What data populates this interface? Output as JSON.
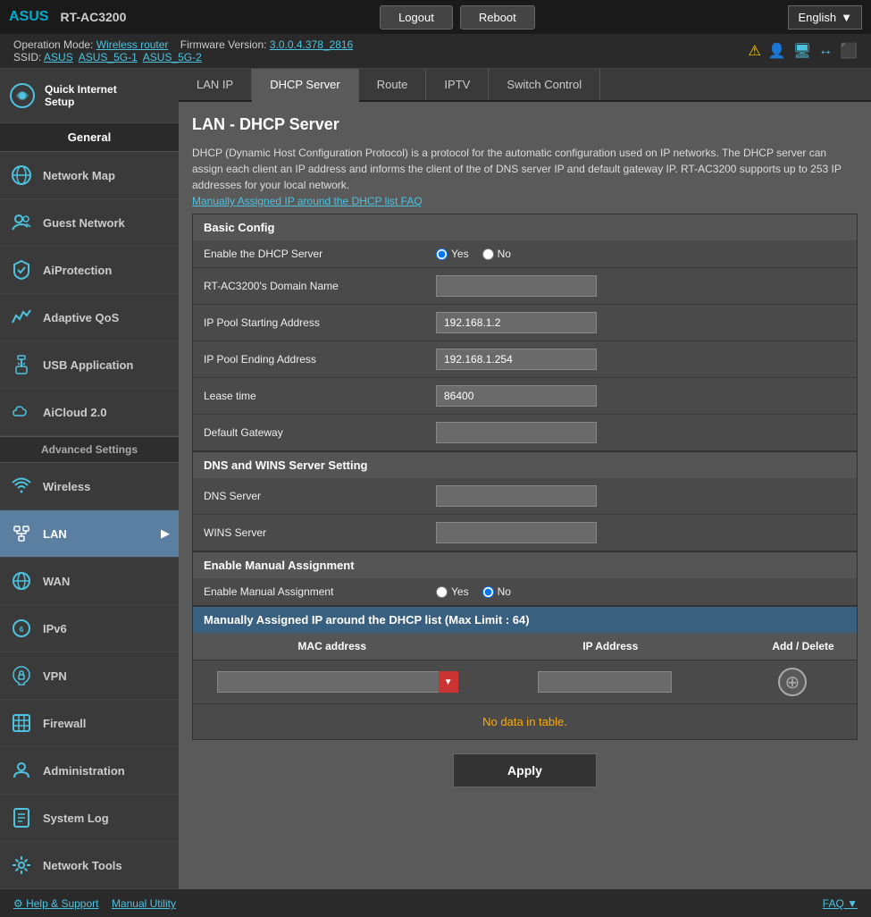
{
  "header": {
    "logo": "ASUS",
    "model": "RT-AC3200",
    "logout_label": "Logout",
    "reboot_label": "Reboot",
    "language": "English"
  },
  "info_bar": {
    "operation_mode_label": "Operation Mode:",
    "operation_mode_value": "Wireless router",
    "firmware_label": "Firmware Version:",
    "firmware_value": "3.0.0.4.378_2816",
    "ssid_label": "SSID:",
    "ssid_values": [
      "ASUS",
      "ASUS_5G-1",
      "ASUS_5G-2"
    ]
  },
  "tabs": [
    {
      "id": "lan-ip",
      "label": "LAN IP"
    },
    {
      "id": "dhcp-server",
      "label": "DHCP Server",
      "active": true
    },
    {
      "id": "route",
      "label": "Route"
    },
    {
      "id": "iptv",
      "label": "IPTV"
    },
    {
      "id": "switch-control",
      "label": "Switch Control"
    }
  ],
  "sidebar": {
    "general_label": "General",
    "quick_setup_label": "Quick Internet\nSetup",
    "items_general": [
      {
        "id": "network-map",
        "label": "Network Map"
      },
      {
        "id": "guest-network",
        "label": "Guest Network"
      },
      {
        "id": "aiprotection",
        "label": "AiProtection"
      },
      {
        "id": "adaptive-qos",
        "label": "Adaptive QoS"
      },
      {
        "id": "usb-application",
        "label": "USB Application"
      },
      {
        "id": "aicloud",
        "label": "AiCloud 2.0"
      }
    ],
    "advanced_label": "Advanced Settings",
    "items_advanced": [
      {
        "id": "wireless",
        "label": "Wireless"
      },
      {
        "id": "lan",
        "label": "LAN",
        "active": true
      },
      {
        "id": "wan",
        "label": "WAN"
      },
      {
        "id": "ipv6",
        "label": "IPv6"
      },
      {
        "id": "vpn",
        "label": "VPN"
      },
      {
        "id": "firewall",
        "label": "Firewall"
      },
      {
        "id": "administration",
        "label": "Administration"
      },
      {
        "id": "system-log",
        "label": "System Log"
      },
      {
        "id": "network-tools",
        "label": "Network Tools"
      }
    ]
  },
  "page": {
    "title": "LAN - DHCP Server",
    "description": "DHCP (Dynamic Host Configuration Protocol) is a protocol for the automatic configuration used on IP networks. The DHCP server can assign each client an IP address and informs the client of the of DNS server IP and default gateway IP. RT-AC3200 supports up to 253 IP addresses for your local network.",
    "faq_link": "Manually Assigned IP around the DHCP list FAQ"
  },
  "basic_config": {
    "section_label": "Basic Config",
    "fields": [
      {
        "id": "enable-dhcp",
        "label": "Enable the DHCP Server",
        "type": "radio",
        "options": [
          "Yes",
          "No"
        ],
        "selected": "Yes"
      },
      {
        "id": "domain-name",
        "label": "RT-AC3200's Domain Name",
        "type": "text",
        "value": ""
      },
      {
        "id": "ip-pool-start",
        "label": "IP Pool Starting Address",
        "type": "text",
        "value": "192.168.1.2"
      },
      {
        "id": "ip-pool-end",
        "label": "IP Pool Ending Address",
        "type": "text",
        "value": "192.168.1.254"
      },
      {
        "id": "lease-time",
        "label": "Lease time",
        "type": "text",
        "value": "86400"
      },
      {
        "id": "default-gateway",
        "label": "Default Gateway",
        "type": "text",
        "value": ""
      }
    ]
  },
  "dns_wins": {
    "section_label": "DNS and WINS Server Setting",
    "fields": [
      {
        "id": "dns-server",
        "label": "DNS Server",
        "type": "text",
        "value": ""
      },
      {
        "id": "wins-server",
        "label": "WINS Server",
        "type": "text",
        "value": ""
      }
    ]
  },
  "manual_assignment": {
    "section_label": "Enable Manual Assignment",
    "fields": [
      {
        "id": "enable-manual",
        "label": "Enable Manual Assignment",
        "type": "radio",
        "options": [
          "Yes",
          "No"
        ],
        "selected": "No"
      }
    ]
  },
  "dhcp_list": {
    "section_label": "Manually Assigned IP around the DHCP list (Max Limit : 64)",
    "columns": [
      "MAC address",
      "IP Address",
      "Add / Delete"
    ],
    "no_data_msg": "No data in table.",
    "add_icon": "⊕"
  },
  "apply_button": "Apply",
  "footer": {
    "help_link": "Help & Support",
    "manual_link": "Manual Utility",
    "faq_link": "FAQ"
  }
}
